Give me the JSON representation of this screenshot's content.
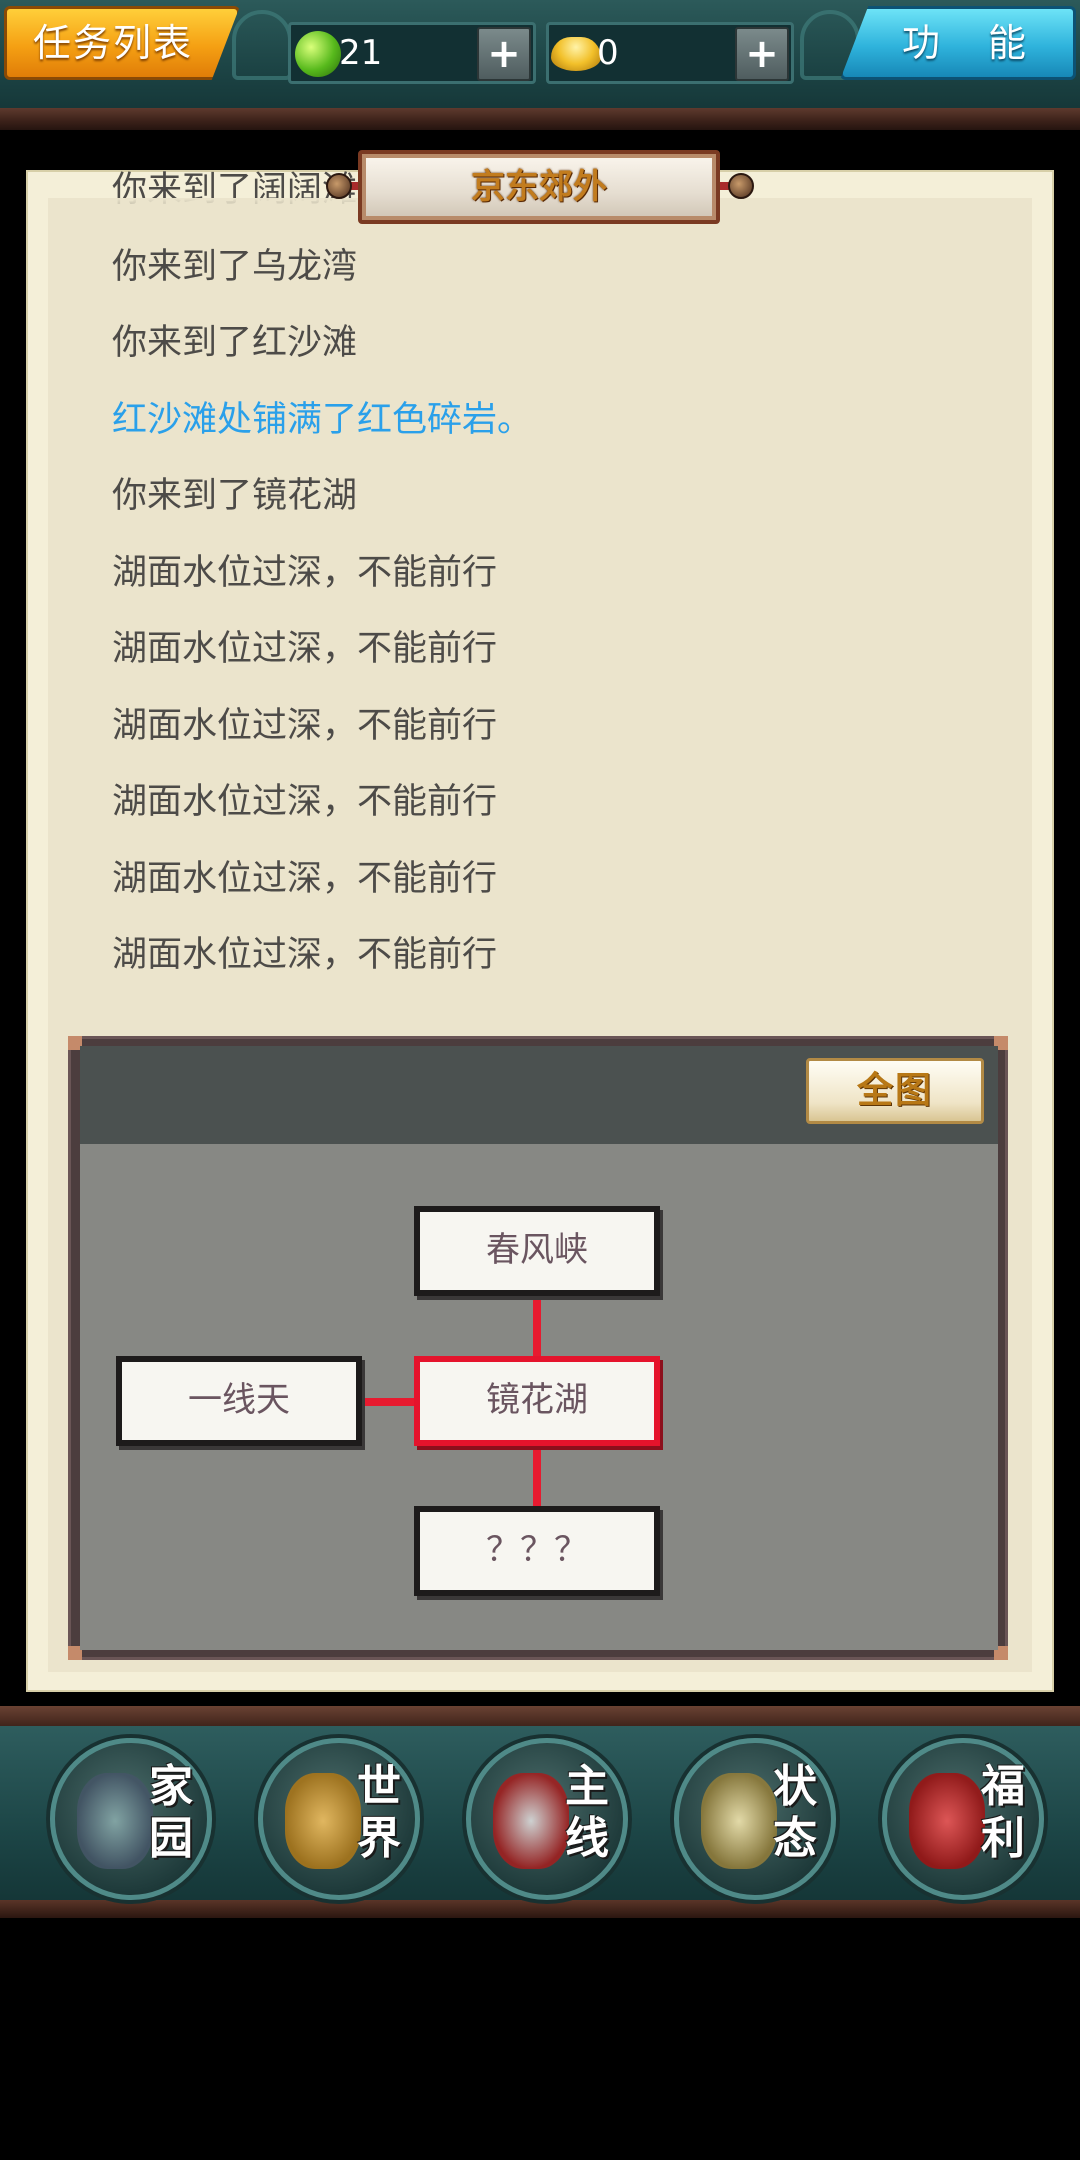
{
  "topbar": {
    "task_list_label": "任务列表",
    "function_label": "功 能",
    "jade": {
      "amount": "21",
      "plus": "+"
    },
    "gold": {
      "amount": "0",
      "plus": "+"
    }
  },
  "location": {
    "title": "京东郊外"
  },
  "log": [
    {
      "text": "你来到了阔阔滩",
      "highlight": false
    },
    {
      "text": "你来到了乌龙湾",
      "highlight": false
    },
    {
      "text": "你来到了红沙滩",
      "highlight": false
    },
    {
      "text": "红沙滩处铺满了红色碎岩。",
      "highlight": true
    },
    {
      "text": "你来到了镜花湖",
      "highlight": false
    },
    {
      "text": "湖面水位过深，不能前行",
      "highlight": false
    },
    {
      "text": "湖面水位过深，不能前行",
      "highlight": false
    },
    {
      "text": "湖面水位过深，不能前行",
      "highlight": false
    },
    {
      "text": "湖面水位过深，不能前行",
      "highlight": false
    },
    {
      "text": "湖面水位过深，不能前行",
      "highlight": false
    },
    {
      "text": "湖面水位过深，不能前行",
      "highlight": false
    }
  ],
  "map": {
    "full_map_label": "全图",
    "nodes": {
      "north": "春风峡",
      "west": "一线天",
      "current": "镜花湖",
      "south": "？？？"
    }
  },
  "bottom_nav": [
    {
      "label": "家园",
      "icon": "home-icon"
    },
    {
      "label": "世界",
      "icon": "world-icon"
    },
    {
      "label": "主线",
      "icon": "main-quest-icon"
    },
    {
      "label": "状态",
      "icon": "status-icon"
    },
    {
      "label": "福利",
      "icon": "welfare-icon"
    }
  ],
  "colors": {
    "highlight_text": "#2aa0ea",
    "current_node_border": "#e5132c",
    "parchment": "#ebe4cc"
  }
}
